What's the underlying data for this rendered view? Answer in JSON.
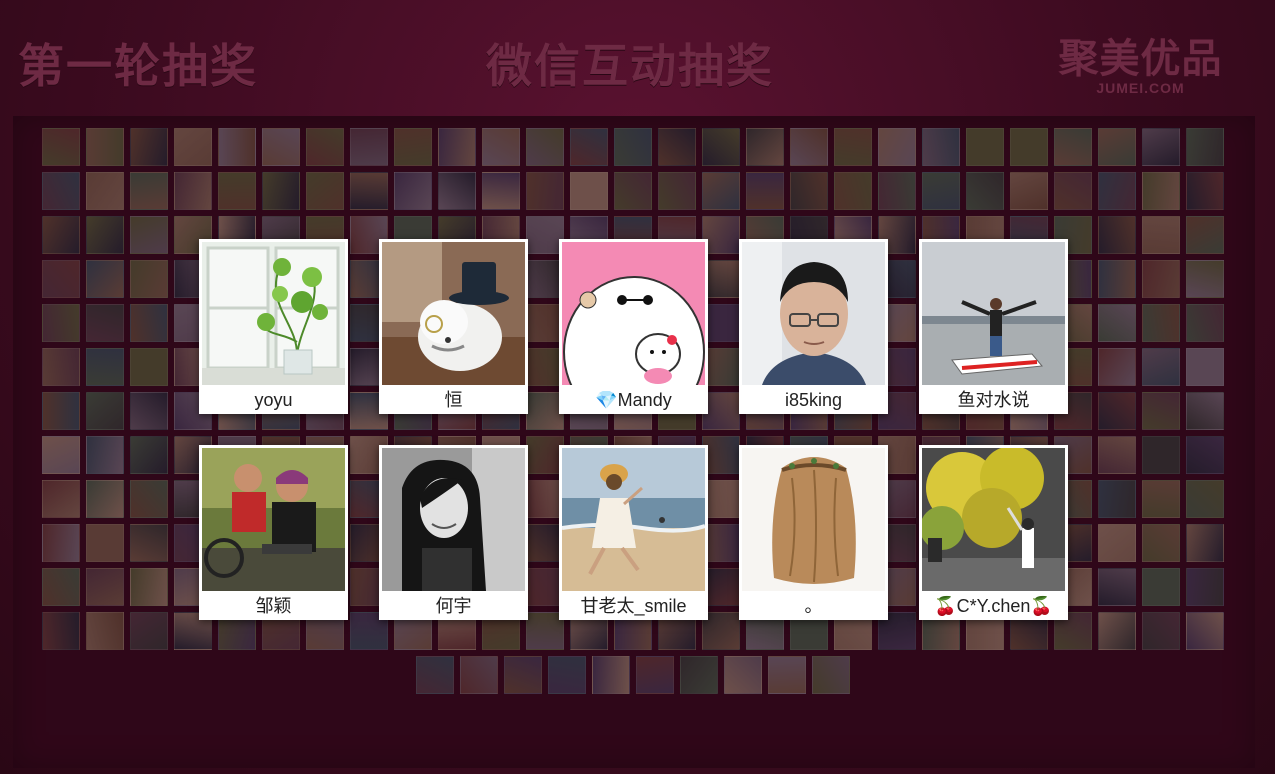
{
  "header": {
    "round_title": "第一轮抽奖",
    "event_title": "微信互动抽奖",
    "brand_cn": "聚美优品",
    "brand_en": "JUMEI.COM"
  },
  "colors": {
    "background": "#3d0b20",
    "header_text": "#6e2a44",
    "card_bg": "#ffffff"
  },
  "winners": [
    {
      "name": "yoyu",
      "icon": "plant-window-icon"
    },
    {
      "name": "恒",
      "icon": "dog-top-hat-icon"
    },
    {
      "name": "💎Mandy",
      "icon": "baymax-hello-kitty-icon"
    },
    {
      "name": "i85king",
      "icon": "man-glasses-portrait-icon"
    },
    {
      "name": "鱼对水说",
      "icon": "jetski-beach-photo-icon"
    },
    {
      "name": "邹颖",
      "icon": "two-men-photo-icon"
    },
    {
      "name": "何宇",
      "icon": "woman-bw-portrait-icon"
    },
    {
      "name": "甘老太_smile",
      "icon": "woman-beach-jump-icon"
    },
    {
      "name": "。",
      "icon": "long-hair-back-icon"
    },
    {
      "name": "🍒C*Y.chen🍒",
      "icon": "yellow-tree-photo-icon"
    }
  ]
}
